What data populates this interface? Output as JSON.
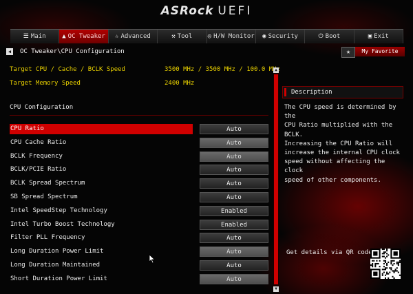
{
  "brand": {
    "name": "ASRock",
    "product": "UEFI"
  },
  "tabs": [
    {
      "label": "Main",
      "icon": "list-icon",
      "active": false
    },
    {
      "label": "OC Tweaker",
      "icon": "flame-icon",
      "active": true
    },
    {
      "label": "Advanced",
      "icon": "star-icon",
      "active": false
    },
    {
      "label": "Tool",
      "icon": "tools-icon",
      "active": false
    },
    {
      "label": "H/W Monitor",
      "icon": "monitor-icon",
      "active": false
    },
    {
      "label": "Security",
      "icon": "shield-icon",
      "active": false
    },
    {
      "label": "Boot",
      "icon": "power-icon",
      "active": false
    },
    {
      "label": "Exit",
      "icon": "exit-icon",
      "active": false
    }
  ],
  "breadcrumb": "OC Tweaker\\CPU Configuration",
  "favorite_label": "My Favorite",
  "info": [
    {
      "label": "Target CPU / Cache / BCLK Speed",
      "value": "3500 MHz / 3500 MHz / 100.0 MHz"
    },
    {
      "label": "Target Memory Speed",
      "value": "2400 MHz"
    }
  ],
  "section_title": "CPU Configuration",
  "settings": [
    {
      "label": "CPU Ratio",
      "value": "Auto",
      "selected": true,
      "dim": false
    },
    {
      "label": "CPU Cache Ratio",
      "value": "Auto",
      "selected": false,
      "dim": true
    },
    {
      "label": "BCLK Frequency",
      "value": "Auto",
      "selected": false,
      "dim": true
    },
    {
      "label": "BCLK/PCIE Ratio",
      "value": "Auto",
      "selected": false,
      "dim": false
    },
    {
      "label": "BCLK Spread Spectrum",
      "value": "Auto",
      "selected": false,
      "dim": false
    },
    {
      "label": "SB Spread Spectrum",
      "value": "Auto",
      "selected": false,
      "dim": false
    },
    {
      "label": "Intel SpeedStep Technology",
      "value": "Enabled",
      "selected": false,
      "dim": false
    },
    {
      "label": "Intel Turbo Boost Technology",
      "value": "Enabled",
      "selected": false,
      "dim": false
    },
    {
      "label": "Filter PLL Frequency",
      "value": "Auto",
      "selected": false,
      "dim": false
    },
    {
      "label": "Long Duration Power Limit",
      "value": "Auto",
      "selected": false,
      "dim": true
    },
    {
      "label": "Long Duration Maintained",
      "value": "Auto",
      "selected": false,
      "dim": false
    },
    {
      "label": "Short Duration Power Limit",
      "value": "Auto",
      "selected": false,
      "dim": true
    }
  ],
  "description": {
    "title": "Description",
    "lines": [
      "The CPU speed is determined by the",
      "CPU Ratio multiplied with the BCLK.",
      "Increasing the CPU Ratio will",
      "increase the internal CPU clock",
      "speed without affecting the clock",
      "speed of other components."
    ]
  },
  "qr_label": "Get details via QR code",
  "colors": {
    "accent": "#d00000",
    "info_text": "#e8d000",
    "background": "#050505"
  }
}
